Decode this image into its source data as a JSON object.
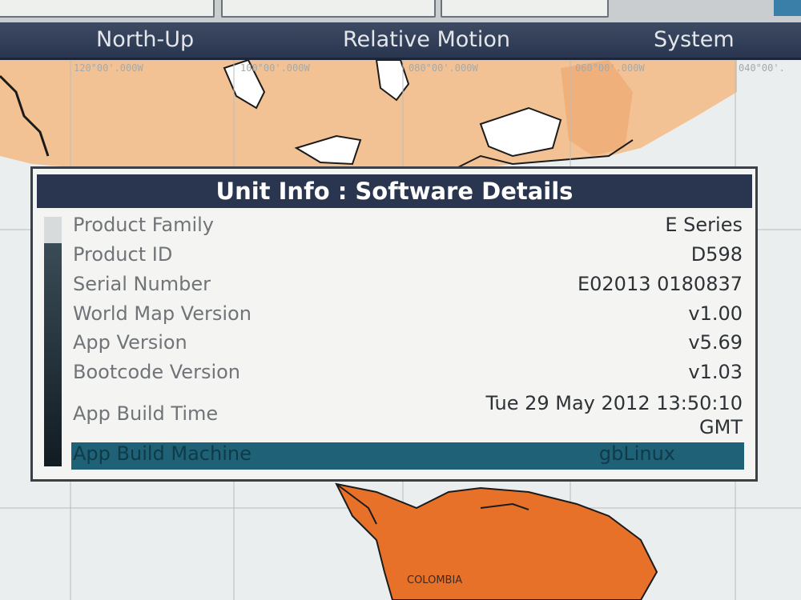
{
  "top_bar": {
    "fields": [
      "",
      "",
      ""
    ]
  },
  "menu": {
    "items": [
      {
        "label": "North-Up"
      },
      {
        "label": "Relative Motion"
      },
      {
        "label": "System"
      }
    ]
  },
  "map": {
    "longitude_labels": [
      "120°00'.000W",
      "100°00'.000W",
      "080°00'.000W",
      "060°00'.000W",
      "040°00'."
    ],
    "country_label": "COLOMBIA",
    "colors": {
      "land_north": "#f3c294",
      "land_south": "#e8712a",
      "sea": "#ebeeee",
      "lake": "#ffffff",
      "grid": "#b9bcbc"
    }
  },
  "dialog": {
    "title": "Unit Info : Software Details",
    "rows": [
      {
        "label": "Product Family",
        "value": "E Series"
      },
      {
        "label": "Product ID",
        "value": "D598"
      },
      {
        "label": "Serial Number",
        "value": "E02013 0180837"
      },
      {
        "label": "World Map Version",
        "value": "v1.00"
      },
      {
        "label": "App Version",
        "value": "v5.69"
      },
      {
        "label": "Bootcode Version",
        "value": "v1.03"
      },
      {
        "label": "App Build Time",
        "value_line1": "Tue 29 May 2012 13:50:10",
        "value_line2": "GMT"
      },
      {
        "label": "App Build Machine",
        "value": "gbLinux",
        "selected": true
      }
    ]
  }
}
